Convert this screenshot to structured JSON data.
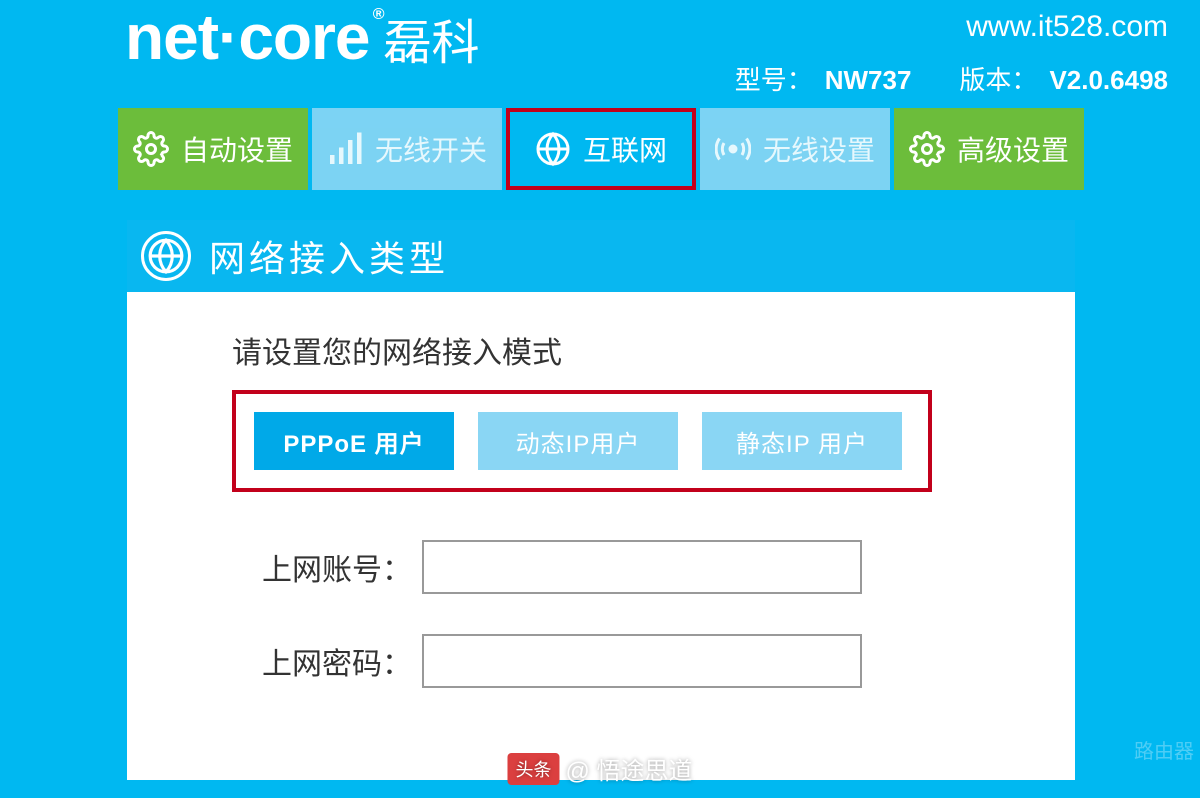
{
  "header": {
    "brand_english": "net·core",
    "brand_chinese": "磊科",
    "register_mark": "®",
    "site_url": "www.it528.com",
    "model_label": "型号：",
    "model_value": "NW737",
    "version_label": "版本：",
    "version_value": "V2.0.6498"
  },
  "nav": {
    "auto": {
      "label": "自动设置",
      "icon": "gear"
    },
    "wireless": {
      "label": "无线开关",
      "icon": "signal"
    },
    "internet": {
      "label": "互联网",
      "icon": "globe"
    },
    "wifi": {
      "label": "无线设置",
      "icon": "antenna"
    },
    "advanced": {
      "label": "高级设置",
      "icon": "gear"
    }
  },
  "panel": {
    "title": "网络接入类型",
    "prompt": "请设置您的网络接入模式",
    "options": {
      "pppoe": "PPPoE 用户",
      "dhcp": "动态IP用户",
      "static": "静态IP 用户"
    },
    "form": {
      "account_label": "上网账号：",
      "password_label": "上网密码：",
      "account_value": "",
      "password_value": ""
    }
  },
  "attribution": {
    "badge": "头条",
    "handle": "@ 悟途思道"
  },
  "side_watermark": "路由器"
}
